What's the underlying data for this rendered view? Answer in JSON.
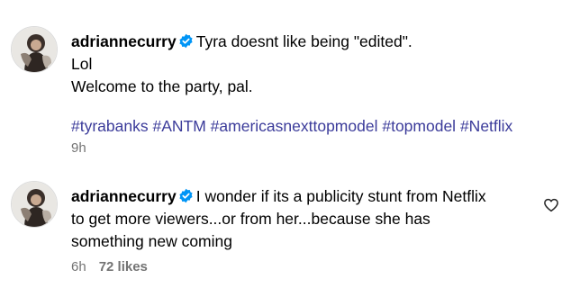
{
  "comments": [
    {
      "username": "adriannecurry",
      "avatar_icon": "profile-photo-avatar",
      "verified_icon": "verified-badge-icon",
      "lines": [
        "Tyra doesnt like being \"edited\".",
        "Lol",
        "Welcome to the party, pal."
      ],
      "hashtags": [
        "#tyrabanks",
        "#ANTM",
        "#americasnexttopmodel",
        "#topmodel",
        "#Netflix"
      ],
      "time": "9h"
    },
    {
      "username": "adriannecurry",
      "avatar_icon": "profile-photo-avatar",
      "verified_icon": "verified-badge-icon",
      "lines": [
        "I wonder if its a publicity stunt from Netflix",
        "to get more viewers...or from her...because she has",
        "something new coming"
      ],
      "time": "6h",
      "likes": "72 likes",
      "like_icon": "heart-icon"
    }
  ],
  "colors": {
    "hashtag": "#3b3b9a",
    "verified": "#0095f6",
    "meta": "#737373"
  }
}
